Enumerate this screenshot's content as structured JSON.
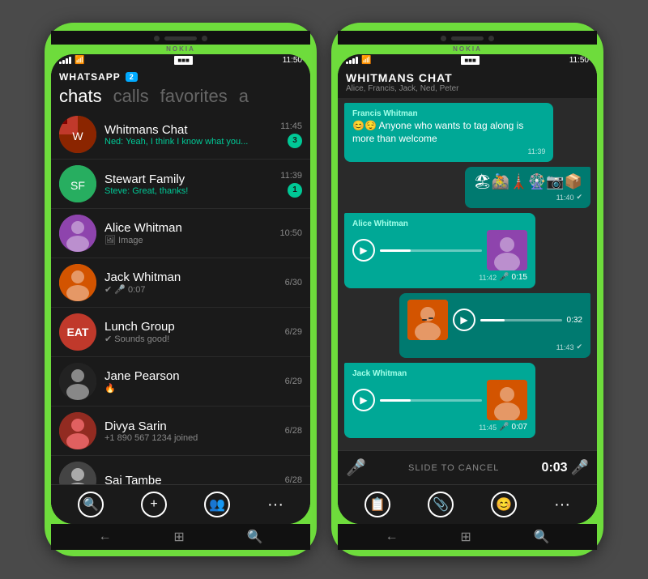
{
  "brand": "NOKIA",
  "status_bar": {
    "time": "11:50",
    "battery": "■■■"
  },
  "left_phone": {
    "app_name": "WHATSAPP",
    "badge": "2",
    "tabs": [
      {
        "label": "chats",
        "active": true
      },
      {
        "label": "calls",
        "active": false
      },
      {
        "label": "favorites",
        "active": false
      },
      {
        "label": "a",
        "active": false
      }
    ],
    "chats": [
      {
        "name": "Whitmans Chat",
        "time": "11:45",
        "preview": "Ned: Yeah, I think I know what you...",
        "unread": "3",
        "color": "teal"
      },
      {
        "name": "Stewart Family",
        "time": "11:39",
        "preview": "Steve: Great, thanks!",
        "unread": "1",
        "color": "green"
      },
      {
        "name": "Alice Whitman",
        "time": "10:50",
        "preview": "🖼 Image",
        "unread": "",
        "color": "purple"
      },
      {
        "name": "Jack Whitman",
        "time": "6/30",
        "preview": "✔ 🎤 0:07",
        "unread": "",
        "color": "orange"
      },
      {
        "name": "Lunch Group",
        "time": "6/29",
        "preview": "✔ Sounds good!",
        "unread": "",
        "color": "red"
      },
      {
        "name": "Jane Pearson",
        "time": "6/29",
        "preview": "🔥",
        "unread": "",
        "color": "dark"
      },
      {
        "name": "Divya Sarin",
        "time": "6/28",
        "preview": "+1 890 567 1234 joined",
        "unread": "",
        "color": "red2"
      },
      {
        "name": "Sai Tambe",
        "time": "6/28",
        "preview": "",
        "unread": "",
        "color": "gray"
      }
    ],
    "toolbar_icons": [
      "🔍",
      "+",
      "👥",
      "···"
    ]
  },
  "right_phone": {
    "chat_name": "WHITMANS CHAT",
    "chat_members": "Alice, Francis, Jack, Ned, Peter",
    "messages": [
      {
        "sender": "Francis Whitman",
        "text": "😊😌 Anyone who wants to tag along is more than welcome",
        "time": "11:39",
        "type": "text",
        "direction": "incoming"
      },
      {
        "sender": "",
        "text": "🏖🚵🗼🎡📷📦",
        "time": "11:40",
        "type": "emoji",
        "direction": "outgoing"
      },
      {
        "sender": "Alice Whitman",
        "text": "",
        "time": "11:42",
        "duration": "0:15",
        "type": "audio_with_thumb",
        "direction": "incoming",
        "thumb": "alice"
      },
      {
        "sender": "",
        "text": "",
        "time": "11:43",
        "duration": "0:32",
        "type": "audio_with_thumb",
        "direction": "outgoing",
        "thumb": "jack"
      },
      {
        "sender": "Jack Whitman",
        "text": "",
        "time": "11:45",
        "duration": "0:07",
        "type": "audio_with_thumb",
        "direction": "incoming",
        "thumb": "jack2"
      }
    ],
    "record_bar": {
      "slide_text": "SLIDE TO CANCEL",
      "timer": "0:03"
    },
    "toolbar_icons": [
      "📋",
      "📎",
      "😊",
      "···"
    ]
  }
}
